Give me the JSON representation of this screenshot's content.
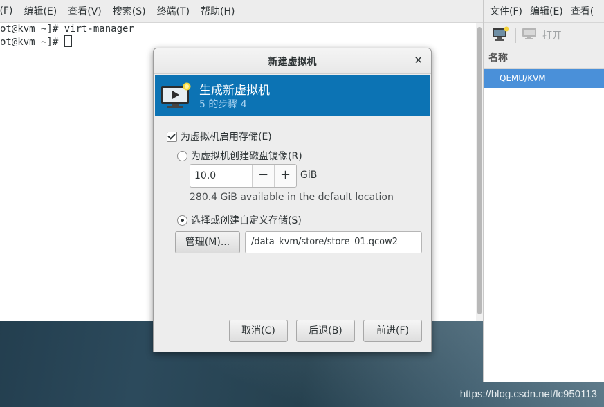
{
  "terminal": {
    "menu": [
      "[(F)",
      "编辑(E)",
      "查看(V)",
      "搜索(S)",
      "终端(T)",
      "帮助(H)"
    ],
    "lines": [
      "ot@kvm ~]# virt-manager",
      "ot@kvm ~]# "
    ]
  },
  "virt_manager": {
    "menu": [
      "文件(F)",
      "编辑(E)",
      "查看("
    ],
    "toolbar_open": "打开",
    "column_header": "名称",
    "connection": "QEMU/KVM",
    "selection_color": "#4a90d9"
  },
  "dialog": {
    "title": "新建虚拟机",
    "close_icon": "close-icon",
    "header_title": "生成新虚拟机",
    "header_step": "5 的步骤 4",
    "header_color": "#0c73b4",
    "enable_storage": {
      "label": "为虚拟机启用存储(E)",
      "checked": true
    },
    "create_disk": {
      "label": "为虚拟机创建磁盘镜像(R)",
      "selected": false
    },
    "disk_size": "10.0",
    "minus_label": "−",
    "plus_label": "+",
    "unit": "GiB",
    "available": "280.4 GiB available in the default location",
    "custom_storage": {
      "label": "选择或创建自定义存储(S)",
      "selected": true
    },
    "manage_label": "管理(M)...",
    "storage_path": "/data_kvm/store/store_01.qcow2",
    "buttons": {
      "cancel": "取消(C)",
      "back": "后退(B)",
      "forward": "前进(F)"
    }
  },
  "watermark": "https://blog.csdn.net/lc950113"
}
